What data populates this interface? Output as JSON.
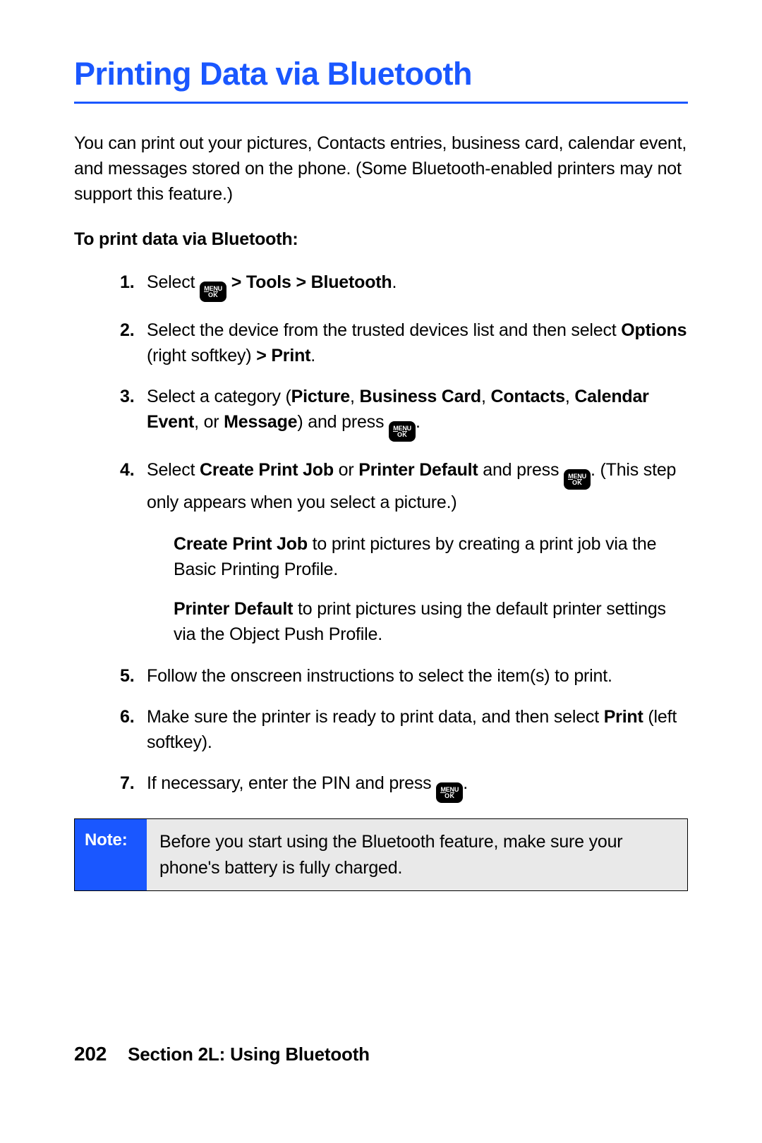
{
  "title": "Printing Data via Bluetooth",
  "intro": "You can print out your pictures, Contacts entries, business card, calendar event, and messages stored on the phone. (Some Bluetooth-enabled printers may not support this feature.)",
  "subhead": "To print data via Bluetooth:",
  "menu_icon": {
    "line1": "MENU",
    "line2": "OK"
  },
  "steps": {
    "s1_a": "Select ",
    "s1_b": " > Tools > Bluetooth",
    "s1_c": ".",
    "s2_a": "Select the device from the trusted devices list and then select ",
    "s2_b": "Options",
    "s2_c": " (right softkey) ",
    "s2_d": "> Print",
    "s2_e": ".",
    "s3_a": "Select a category (",
    "s3_b": "Picture",
    "s3_c": ", ",
    "s3_d": "Business Card",
    "s3_e": ", ",
    "s3_f": "Contacts",
    "s3_g": ", ",
    "s3_h": "Calendar Event",
    "s3_i": ", or ",
    "s3_j": "Message",
    "s3_k": ") and press ",
    "s3_l": ".",
    "s4_a": "Select ",
    "s4_b": "Create Print Job",
    "s4_c": " or ",
    "s4_d": "Printer Default",
    "s4_e": " and press ",
    "s4_f": ". (This step only appears when you select a picture.)",
    "s4_sub1_a": "Create Print Job",
    "s4_sub1_b": " to print pictures by creating a print job via the Basic Printing Profile.",
    "s4_sub2_a": "Printer Default",
    "s4_sub2_b": " to print pictures using the default printer settings via the Object Push Profile.",
    "s5": "Follow the onscreen instructions to select the item(s) to print.",
    "s6_a": "Make sure the printer is ready to print data, and then select ",
    "s6_b": "Print",
    "s6_c": " (left softkey).",
    "s7_a": "If necessary, enter the PIN and press ",
    "s7_b": "."
  },
  "note": {
    "label": "Note:",
    "text": "Before you start using the Bluetooth feature, make sure your phone's battery is fully charged."
  },
  "footer": {
    "page": "202",
    "section": "Section 2L: Using Bluetooth"
  }
}
